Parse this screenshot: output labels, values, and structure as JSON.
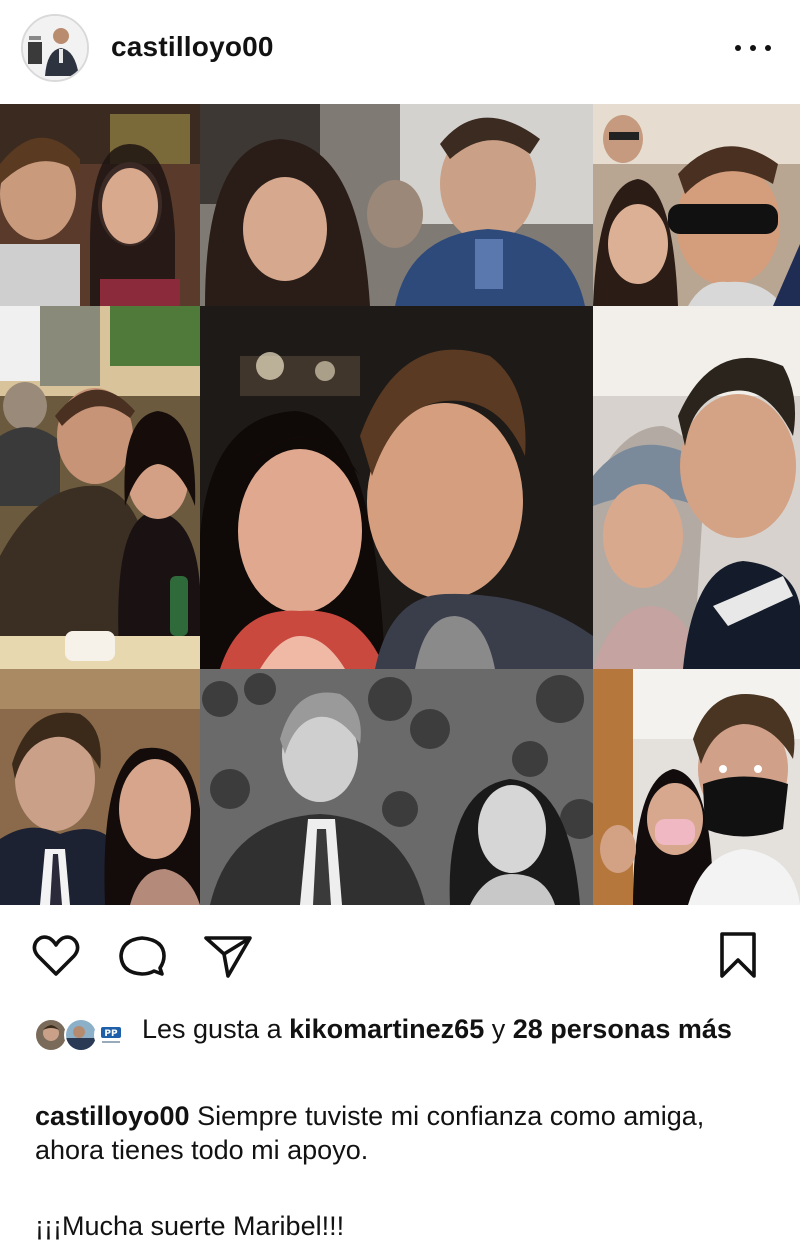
{
  "post": {
    "username": "castilloyo00",
    "avatar_label": "castilloyo00 avatar"
  },
  "collage": {
    "tiles": [
      {
        "name": "photo-1",
        "desc": "selfie couple bar"
      },
      {
        "name": "photo-2",
        "desc": "couple night"
      },
      {
        "name": "photo-3",
        "desc": "selfie sunglasses"
      },
      {
        "name": "photo-4",
        "desc": "couple at table"
      },
      {
        "name": "photo-5",
        "desc": "couple night center"
      },
      {
        "name": "photo-6",
        "desc": "selfie hat"
      },
      {
        "name": "photo-7",
        "desc": "couple restaurant"
      },
      {
        "name": "photo-8",
        "desc": "black and white couple"
      },
      {
        "name": "photo-9",
        "desc": "selfie masks"
      }
    ]
  },
  "actions": {
    "like": "heart-icon",
    "comment": "comment-icon",
    "share": "send-icon",
    "save": "bookmark-icon"
  },
  "likes": {
    "prefix": "Les gusta a",
    "user": "kikomartinez65",
    "connector": "y",
    "others": "28 personas más",
    "pp_badge": "PP"
  },
  "caption": {
    "username": "castilloyo00",
    "text": "Siempre tuviste mi confianza como amiga, ahora tienes todo mi apoyo.",
    "line2": "¡¡¡Mucha suerte Maribel!!!"
  },
  "colors": {
    "text": "#121212",
    "background": "#ffffff"
  }
}
